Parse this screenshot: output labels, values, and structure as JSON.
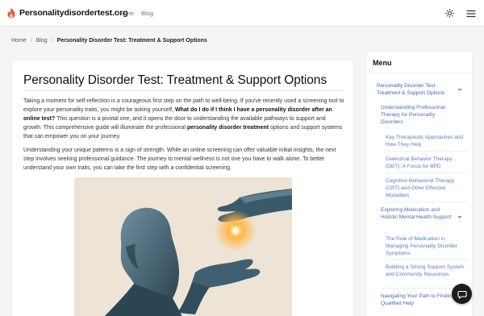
{
  "header": {
    "logo_text": "Personalitydisordertest.org",
    "nav": [
      {
        "label": "Home"
      },
      {
        "label": "Blog"
      }
    ],
    "theme_icon": "sun-icon",
    "menu_icon": "hamburger-icon"
  },
  "breadcrumb": {
    "items": [
      "Home",
      "Blog"
    ],
    "current": "Personality Disorder Test: Treatment & Support Options",
    "separator": "/"
  },
  "article": {
    "title": "Personality Disorder Test: Treatment & Support Options",
    "p1_a": "Taking a moment for self-reflection is a courageous first step on the path to well-being. If you've recently used a screening tool to explore your personality traits, you might be asking yourself, ",
    "p1_b": "What do I do if I think I have a personality disorder after an online test?",
    "p1_c": " This question is a pivotal one, and it opens the door to understanding the available pathways to support and growth. This comprehensive guide will illuminate the professional ",
    "p1_d": "personality disorder treatment",
    "p1_e": " options and support systems that can empower you on your journey.",
    "p2": "Understanding your unique patterns is a sign of strength. While an online screening can offer valuable initial insights, the next step involves seeking professional guidance. The journey to mental wellness is not one you have to walk alone. To better understand your own traits, you can take the first step with a confidential screening."
  },
  "sidebar": {
    "title": "Menu",
    "items": [
      {
        "label": "Personality Disorder Test: Treatment & Support Options"
      },
      {
        "label": "Understanding Professional Therapy for Personality Disorders"
      },
      {
        "label": "Key Therapeutic Approaches and How They Help"
      },
      {
        "label": "Dialectical Behavior Therapy (DBT): A Focus for BPD"
      },
      {
        "label": "Cognitive Behavioral Therapy (CBT) and Other Effective Modalities"
      },
      {
        "label": "Exploring Medication and Holistic Mental Health Support"
      },
      {
        "label": "The Role of Medication in Managing Personality Disorder Symptoms"
      },
      {
        "label": "Building a Strong Support System and Community Resources"
      },
      {
        "label": "Navigating Your Path to Finding Qualified Help"
      }
    ]
  },
  "chat": {
    "icon": "chat-bubble-icon"
  }
}
